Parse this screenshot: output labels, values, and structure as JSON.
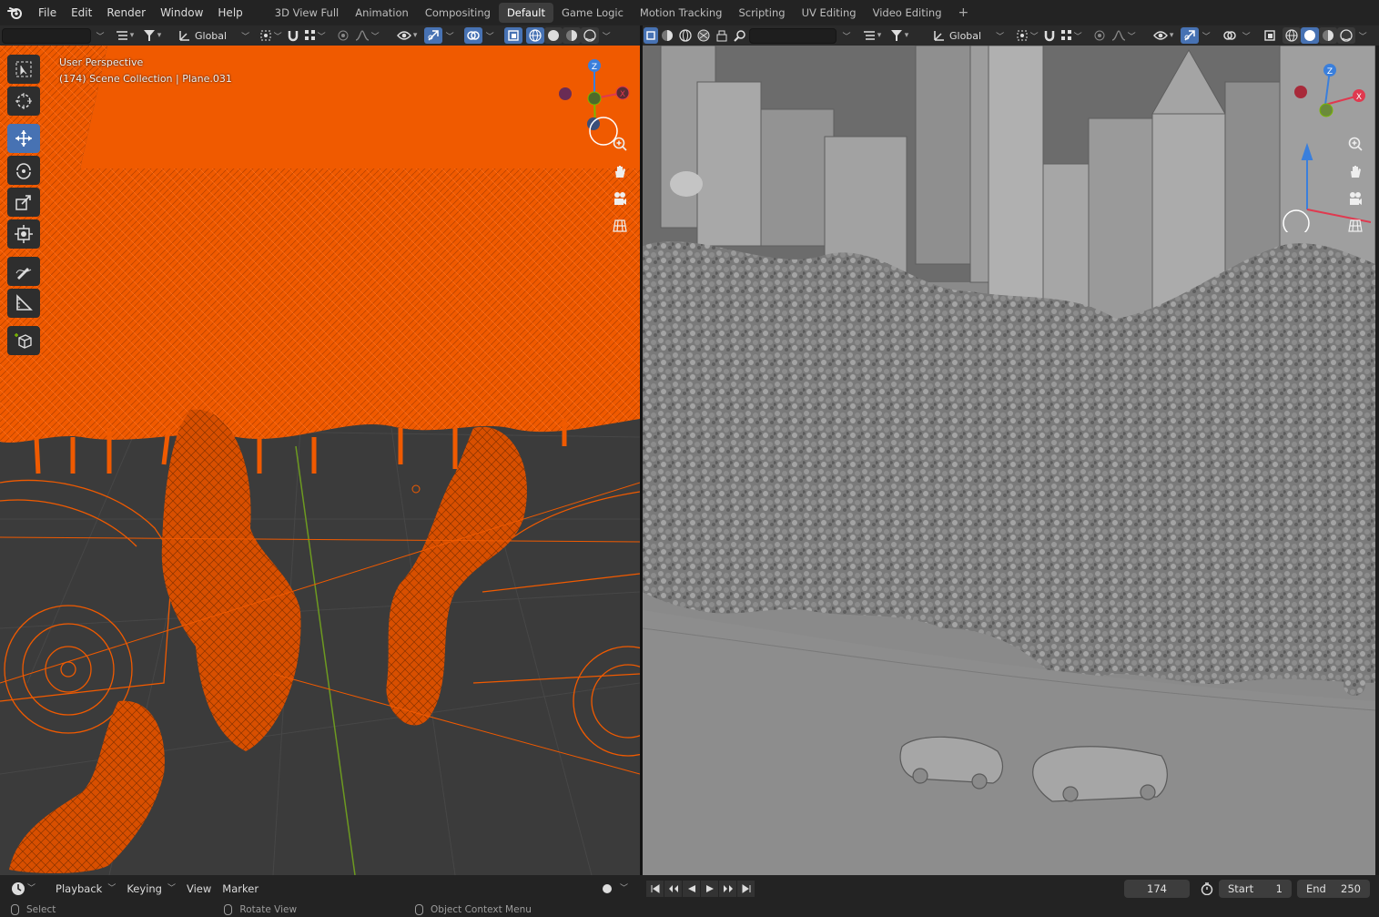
{
  "menu": {
    "items": [
      "File",
      "Edit",
      "Render",
      "Window",
      "Help"
    ],
    "workspaces": [
      "3D View Full",
      "Animation",
      "Compositing",
      "Default",
      "Game Logic",
      "Motion Tracking",
      "Scripting",
      "UV Editing",
      "Video Editing"
    ],
    "active_workspace": "Default",
    "add_tab_symbol": "+"
  },
  "left_header": {
    "orientation": "Global"
  },
  "right_header": {
    "orientation": "Global"
  },
  "left_viewport": {
    "perspective": "User Perspective",
    "context": "(174) Scene Collection | Plane.031",
    "shading": "wireframe",
    "selection_color": "#f05a00"
  },
  "right_viewport": {
    "shading": "solid"
  },
  "gizmo_axes": {
    "x": "X",
    "y": "Y",
    "z": "Z"
  },
  "timeline": {
    "playback": "Playback",
    "keying": "Keying",
    "view": "View",
    "marker": "Marker",
    "current_frame": "174",
    "start_label": "Start",
    "start_value": "1",
    "end_label": "End",
    "end_value": "250"
  },
  "status": {
    "select": "Select",
    "rotate_view": "Rotate View",
    "context_menu": "Object Context Menu"
  },
  "colors": {
    "accent": "#4772b3",
    "axis_x": "#e0394f",
    "axis_y": "#7ab800",
    "axis_z": "#3a7fdc",
    "wire_orange": "#f05a00"
  }
}
